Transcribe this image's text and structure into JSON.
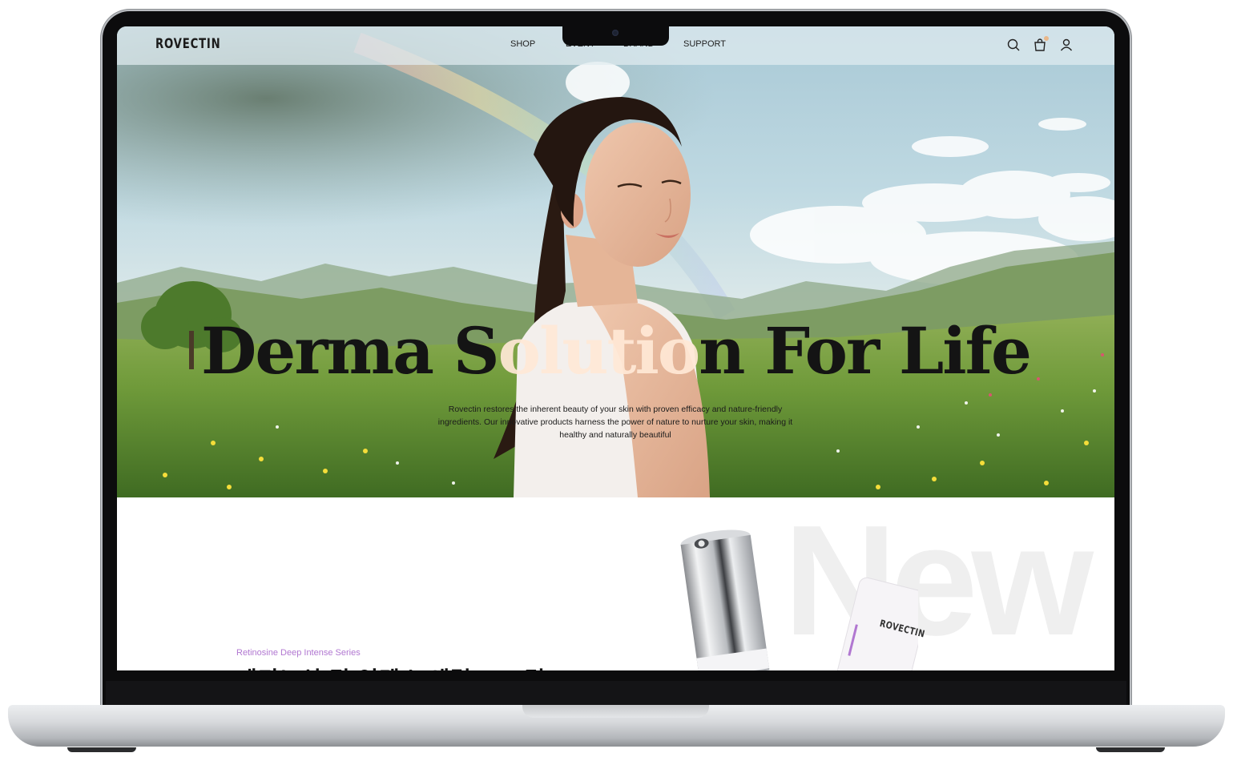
{
  "site": {
    "logo": "ROVECTIN",
    "nav": [
      "SHOP",
      "EVENT",
      "BRAND",
      "SUPPORT"
    ],
    "icons": [
      "search-icon",
      "cart-icon",
      "user-icon"
    ]
  },
  "hero": {
    "title_before": "Derma S",
    "title_accent": "olutio",
    "title_after": "n For Life",
    "description": "Rovectin restores the inherent beauty of your skin with proven efficacy and nature-friendly ingredients. Our innovative products harness the power of nature to nurture your skin, making it healthy and naturally beautiful"
  },
  "product_section": {
    "watermark": "New",
    "series_label": "Retinosine Deep Intense Series",
    "series_title": "레티노신 딥 인텐스 세럼 & 크림",
    "tube_brand": "ROVECTIN"
  },
  "colors": {
    "accent_purple": "#b177d1",
    "title_accent": "#ffe8d6",
    "text_dark": "#141414"
  }
}
